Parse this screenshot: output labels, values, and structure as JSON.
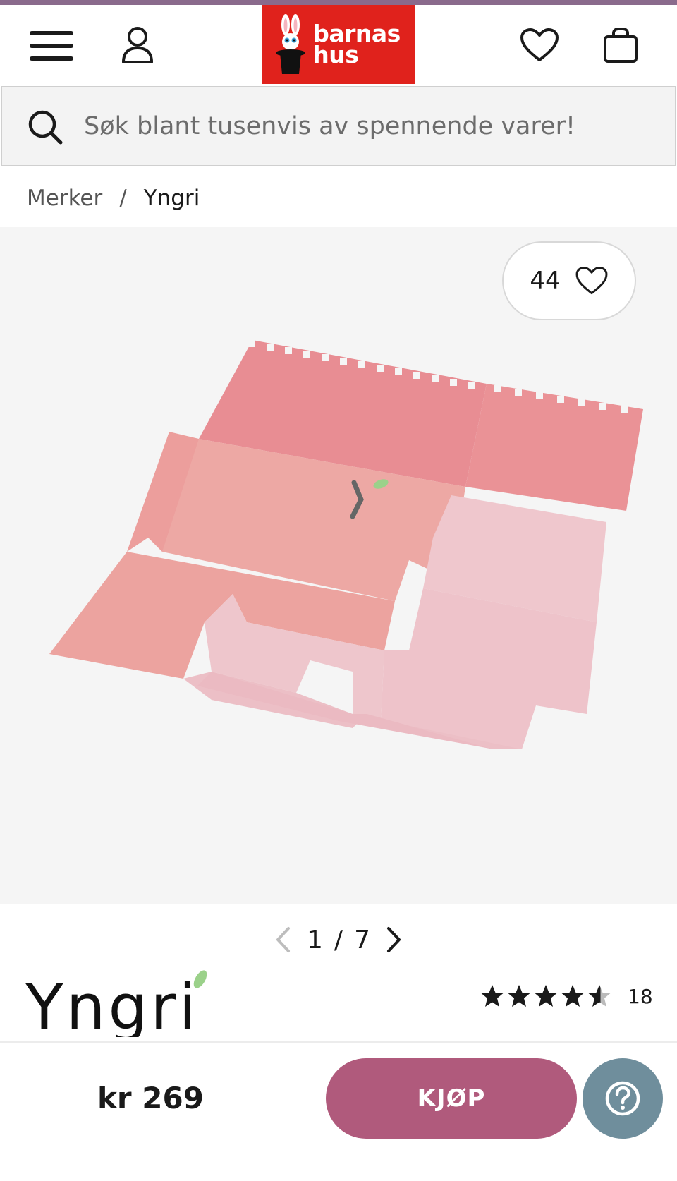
{
  "header": {
    "logo_line1": "barnas",
    "logo_line2": "hus",
    "brand_color": "#e0221c"
  },
  "search": {
    "placeholder": "Søk blant tusenvis av spennende varer!"
  },
  "breadcrumb": {
    "items": [
      "Merker",
      "Yngri"
    ],
    "separator": "/"
  },
  "gallery": {
    "favorite_count": "44",
    "current": "1",
    "separator": "/",
    "total": "7"
  },
  "product": {
    "brand_logo_text": "Yngri",
    "rating_value": 4.5,
    "rating_max": 5,
    "review_count": "18"
  },
  "purchase": {
    "price": "kr 269",
    "buy_label": "KJØP",
    "buy_color": "#b05a7c",
    "help_color": "#6f8e9c"
  },
  "icons": [
    "menu-icon",
    "user-icon",
    "heart-icon",
    "shopping-bag-icon",
    "search-icon",
    "chevron-left-icon",
    "chevron-right-icon",
    "star-icon",
    "help-icon"
  ]
}
